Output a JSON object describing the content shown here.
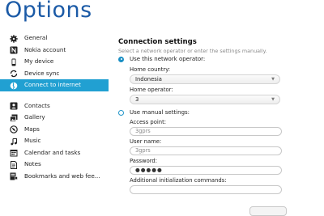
{
  "app": {
    "title": "Options"
  },
  "sidebar": {
    "items": [
      {
        "label": "General",
        "icon": "gear-icon"
      },
      {
        "label": "Nokia account",
        "icon": "nokia-account-icon"
      },
      {
        "label": "My device",
        "icon": "phone-icon"
      },
      {
        "label": "Device sync",
        "icon": "sync-icon"
      },
      {
        "label": "Connect to internet",
        "icon": "globe-icon",
        "active": true
      },
      {
        "label": "Contacts",
        "icon": "contacts-icon"
      },
      {
        "label": "Gallery",
        "icon": "gallery-icon"
      },
      {
        "label": "Maps",
        "icon": "compass-icon"
      },
      {
        "label": "Music",
        "icon": "music-icon"
      },
      {
        "label": "Calendar and tasks",
        "icon": "calendar-icon"
      },
      {
        "label": "Notes",
        "icon": "notes-icon"
      },
      {
        "label": "Bookmarks and web fee...",
        "icon": "bookmarks-icon"
      }
    ]
  },
  "connection": {
    "title": "Connection settings",
    "description": "Select a network operator or enter the settings manually.",
    "use_network": {
      "label": "Use this network operator:",
      "checked": true
    },
    "home_country": {
      "label": "Home country:",
      "value": "Indonesia"
    },
    "home_operator": {
      "label": "Home operator:",
      "value": "3"
    },
    "use_manual": {
      "label": "Use manual settings:",
      "checked": false
    },
    "access_point": {
      "label": "Access point:",
      "value": "3gprs"
    },
    "user_name": {
      "label": "User name:",
      "value": "3gprs"
    },
    "password": {
      "label": "Password:",
      "value": "●●●●●"
    },
    "init_commands": {
      "label": "Additional initialization commands:",
      "value": ""
    }
  },
  "colors": {
    "title": "#1b5aa6",
    "accent": "#21a0d2"
  }
}
